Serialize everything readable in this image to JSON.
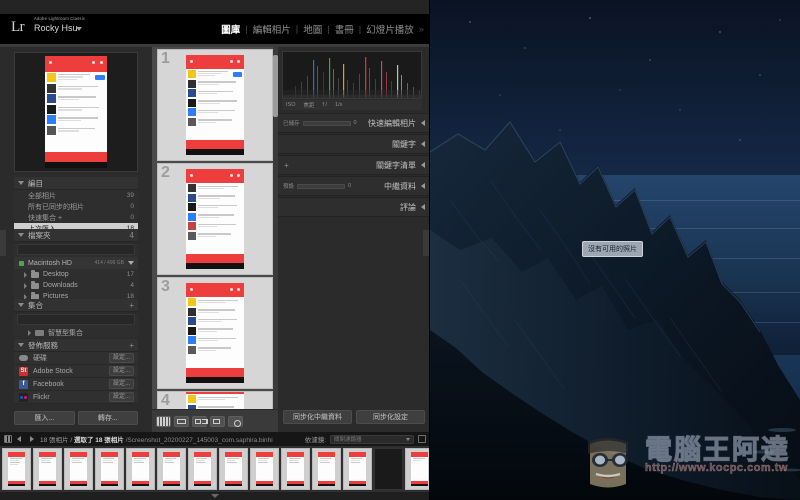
{
  "app": {
    "logo": "Lr",
    "name": "Adobe Lightroom Classic",
    "user": "Rocky Hsu",
    "modules": [
      {
        "label": "圖庫",
        "active": true
      },
      {
        "label": "編輯相片",
        "active": false
      },
      {
        "label": "地圖",
        "active": false
      },
      {
        "label": "書冊",
        "active": false
      },
      {
        "label": "幻燈片播放",
        "active": false
      }
    ],
    "modules_overflow": "»",
    "module_separator": "|"
  },
  "left_panel": {
    "catalog": {
      "title": "編目",
      "items": [
        {
          "label": "全部相片",
          "count": "39"
        },
        {
          "label": "所有已同步的相片",
          "count": "0"
        },
        {
          "label": "快速集合 +",
          "count": "0"
        },
        {
          "label": "上次匯入",
          "count": "18",
          "selected": true
        }
      ]
    },
    "folders": {
      "title": "檔案夾",
      "count": "4",
      "search_placeholder": "",
      "drive": {
        "label": "Macintosh HD",
        "meta": "414 / 499 GB"
      },
      "items": [
        {
          "label": "Desktop",
          "count": "17"
        },
        {
          "label": "Downloads",
          "count": "4"
        },
        {
          "label": "Pictures",
          "count": "18"
        }
      ]
    },
    "collections": {
      "title": "集合",
      "plus": "+",
      "search_placeholder": "",
      "items": [
        {
          "label": "智慧型集合"
        }
      ]
    },
    "publish_services": {
      "title": "發佈服務",
      "plus": "+",
      "items": [
        {
          "label": "硬碟",
          "icon": "harddisk-icon",
          "action": "設定..."
        },
        {
          "label": "Adobe Stock",
          "icon": "adobe-stock-icon",
          "action": "設定..."
        },
        {
          "label": "Facebook",
          "icon": "facebook-icon",
          "action": "設定..."
        },
        {
          "label": "Flickr",
          "icon": "flickr-icon",
          "action": "設定..."
        }
      ]
    },
    "import_button": "匯入...",
    "export_button": "轉存..."
  },
  "center": {
    "cells": [
      {
        "index": "1"
      },
      {
        "index": "2"
      },
      {
        "index": "3"
      },
      {
        "index": "4"
      }
    ],
    "view_modes": [
      {
        "name": "grid-view-icon",
        "active": true
      },
      {
        "name": "loupe-view-icon",
        "active": false
      },
      {
        "name": "compare-view-icon",
        "active": false
      },
      {
        "name": "survey-view-icon",
        "active": false
      },
      {
        "name": "people-view-icon",
        "active": false
      }
    ]
  },
  "right_panel": {
    "histogram": {
      "meta": [
        "ISO",
        "焦距",
        "f /",
        "1/s"
      ]
    },
    "sections": [
      {
        "label": "快速編輯相片",
        "slider_label": "已儲存",
        "slider_value": "0",
        "has_slider": true,
        "has_plus": false
      },
      {
        "label": "關鍵字",
        "slider_label": "",
        "slider_value": "",
        "has_slider": false,
        "has_plus": false
      },
      {
        "label": "關鍵字清單",
        "slider_label": "",
        "slider_value": "",
        "has_slider": false,
        "has_plus": true
      },
      {
        "label": "中繼資料",
        "slider_label": "預設",
        "slider_value": "0",
        "has_slider": true,
        "has_plus": false
      },
      {
        "label": "評論",
        "slider_label": "",
        "slider_value": "",
        "has_slider": false,
        "has_plus": false
      }
    ],
    "sync_metadata_button": "同步化中繼資料",
    "sync_settings_button": "同步化設定"
  },
  "status_bar": {
    "photo_count": "18 張相片 /",
    "selected": "選取了 18 張相片",
    "filename": "/Screenshot_20200227_145003_com.saphira.binhi",
    "filter_label": "依濾鏡:",
    "filter_value": "關閉濾鏡器"
  },
  "filmstrip": {
    "cells": [
      {
        "dark": false
      },
      {
        "dark": false
      },
      {
        "dark": false
      },
      {
        "dark": false
      },
      {
        "dark": false
      },
      {
        "dark": false
      },
      {
        "dark": false
      },
      {
        "dark": false
      },
      {
        "dark": false
      },
      {
        "dark": false
      },
      {
        "dark": false
      },
      {
        "dark": false
      },
      {
        "dark": true
      },
      {
        "dark": false
      }
    ]
  },
  "desktop": {
    "tooltip": "沒有可用的照片",
    "watermark_text": "電腦王阿達",
    "watermark_url": "http://www.kocpc.com.tw"
  },
  "colors": {
    "accent_red": "#ed3d3d",
    "panel_bg": "#2b2b2b",
    "selected_row": "#cfcfcf",
    "facebook_blue": "#3b5998",
    "stock_red": "#d32e2e"
  }
}
